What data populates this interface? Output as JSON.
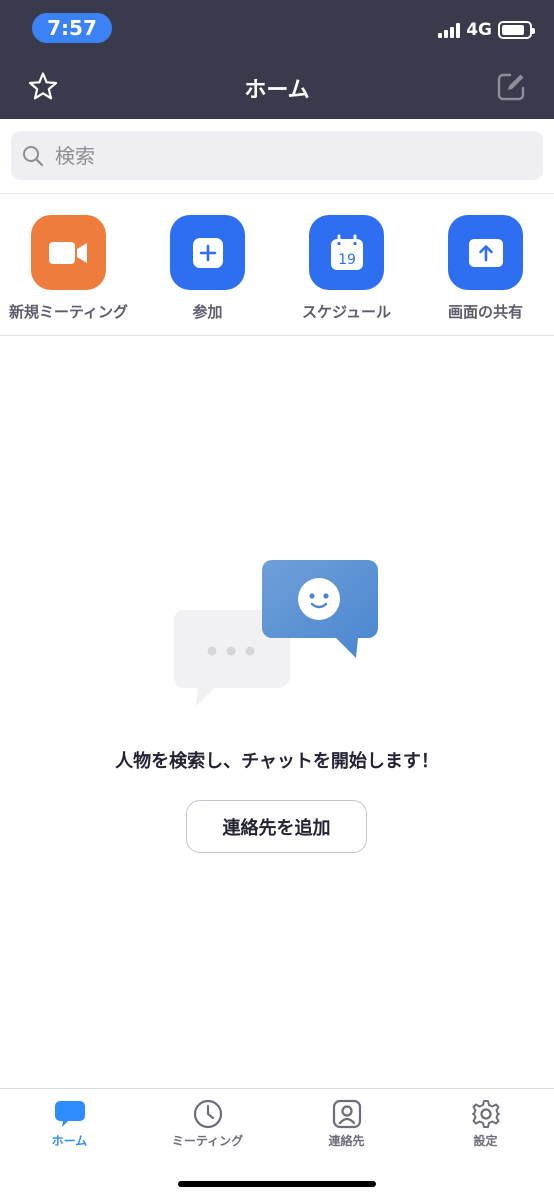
{
  "status_bar": {
    "time": "7:57",
    "network": "4G",
    "battery_level": 0.85
  },
  "header": {
    "title": "ホーム",
    "left_icon": "star-icon",
    "right_icon": "edit-icon"
  },
  "search": {
    "placeholder": "検索"
  },
  "quick_actions": [
    {
      "label": "新規ミーティング",
      "icon": "video-camera-icon",
      "color": "#ee7d3d"
    },
    {
      "label": "参加",
      "icon": "plus-icon",
      "color": "#2d6ff0"
    },
    {
      "label": "スケジュール",
      "icon": "calendar-icon",
      "icon_text": "19",
      "color": "#2d6ff0"
    },
    {
      "label": "画面の共有",
      "icon": "share-screen-icon",
      "color": "#2d6ff0"
    }
  ],
  "empty_state": {
    "message": "人物を検索し、チャットを開始します！",
    "button_label": "連絡先を追加"
  },
  "tabbar": {
    "items": [
      {
        "label": "ホーム",
        "icon": "chat-bubble-icon",
        "active": true
      },
      {
        "label": "ミーティング",
        "icon": "clock-icon",
        "active": false
      },
      {
        "label": "連絡先",
        "icon": "contact-icon",
        "active": false
      },
      {
        "label": "設定",
        "icon": "gear-icon",
        "active": false
      }
    ]
  },
  "colors": {
    "header_bg": "#393a4b",
    "accent": "#2d8cff",
    "orange": "#ee7d3d",
    "blue_tile": "#2d6ff0"
  }
}
